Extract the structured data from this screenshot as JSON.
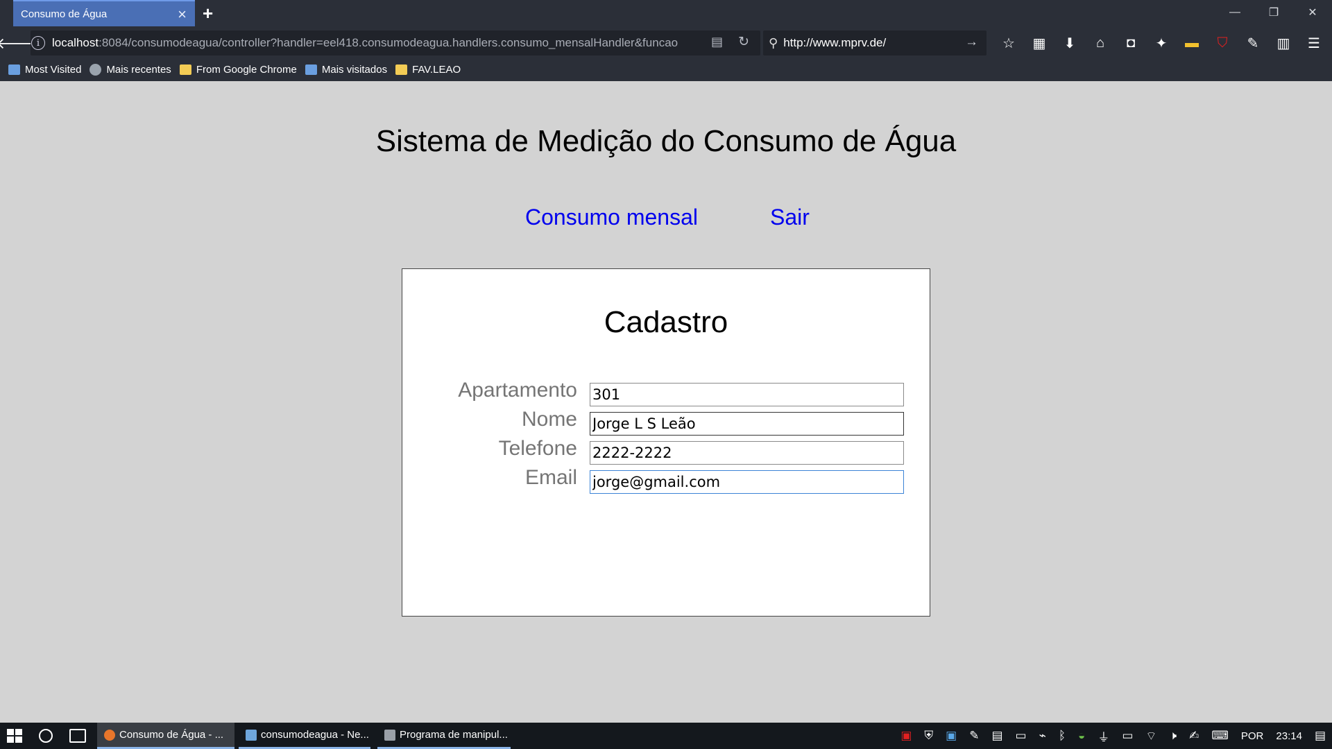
{
  "browser": {
    "tab_title": "Consumo de Água",
    "url_host": "localhost",
    "url_rest": ":8084/consumodeagua/controller?handler=eel418.consumodeagua.handlers.consumo_mensalHandler&funcao",
    "search_value": "http://www.mprv.de/",
    "bookmarks": [
      {
        "label": "Most Visited"
      },
      {
        "label": "Mais recentes"
      },
      {
        "label": "From Google Chrome"
      },
      {
        "label": "Mais visitados"
      },
      {
        "label": "FAV.LEAO"
      }
    ]
  },
  "page": {
    "title": "Sistema de Medição do Consumo de Água",
    "nav": {
      "consumo_label": "Consumo mensal",
      "sair_label": "Sair"
    },
    "form": {
      "title": "Cadastro",
      "fields": [
        {
          "label": "Apartamento",
          "value": "301"
        },
        {
          "label": "Nome",
          "value": "Jorge L S Leão"
        },
        {
          "label": "Telefone",
          "value": "2222-2222"
        },
        {
          "label": "Email",
          "value": "jorge@gmail.com"
        }
      ]
    }
  },
  "taskbar": {
    "items": [
      {
        "label": "Consumo de Água - ..."
      },
      {
        "label": "consumodeagua - Ne..."
      },
      {
        "label": "Programa de manipul..."
      }
    ],
    "language": "POR",
    "time": "23:14"
  },
  "colors": {
    "page_bg": "#d3d3d3",
    "link": "#0000ee",
    "tab_active": "#4a6fb5",
    "chrome_bg": "#2b2f38"
  }
}
